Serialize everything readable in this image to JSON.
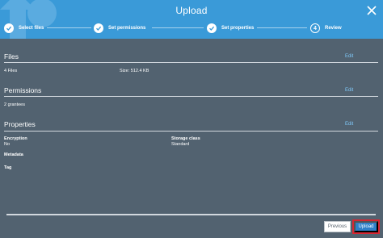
{
  "dialog": {
    "title": "Upload"
  },
  "steps": [
    {
      "label": "Select files",
      "state": "complete"
    },
    {
      "label": "Set permissions",
      "state": "complete"
    },
    {
      "label": "Set properties",
      "state": "complete"
    },
    {
      "label": "Review",
      "state": "current",
      "number": "4"
    }
  ],
  "sections": {
    "files": {
      "title": "Files",
      "edit": "Edit",
      "count": "4 Files",
      "size": "Size: 512.4 KB"
    },
    "permissions": {
      "title": "Permissions",
      "edit": "Edit",
      "grantees": "2 grantees"
    },
    "properties": {
      "title": "Properties",
      "edit": "Edit",
      "encryption_label": "Encryption",
      "encryption_value": "No",
      "storage_label": "Storage class",
      "storage_value": "Standard",
      "metadata_label": "Metadata",
      "tag_label": "Tag"
    }
  },
  "footer": {
    "previous_label": "Previous",
    "upload_label": "Upload"
  },
  "colors": {
    "header": "#3a9ad8",
    "body": "#526270",
    "link": "#7fc8f8",
    "primary": "#2f80c8",
    "highlight": "#d72632"
  },
  "icons": [
    "upload-arrow-icon",
    "close-icon",
    "check-icon"
  ]
}
